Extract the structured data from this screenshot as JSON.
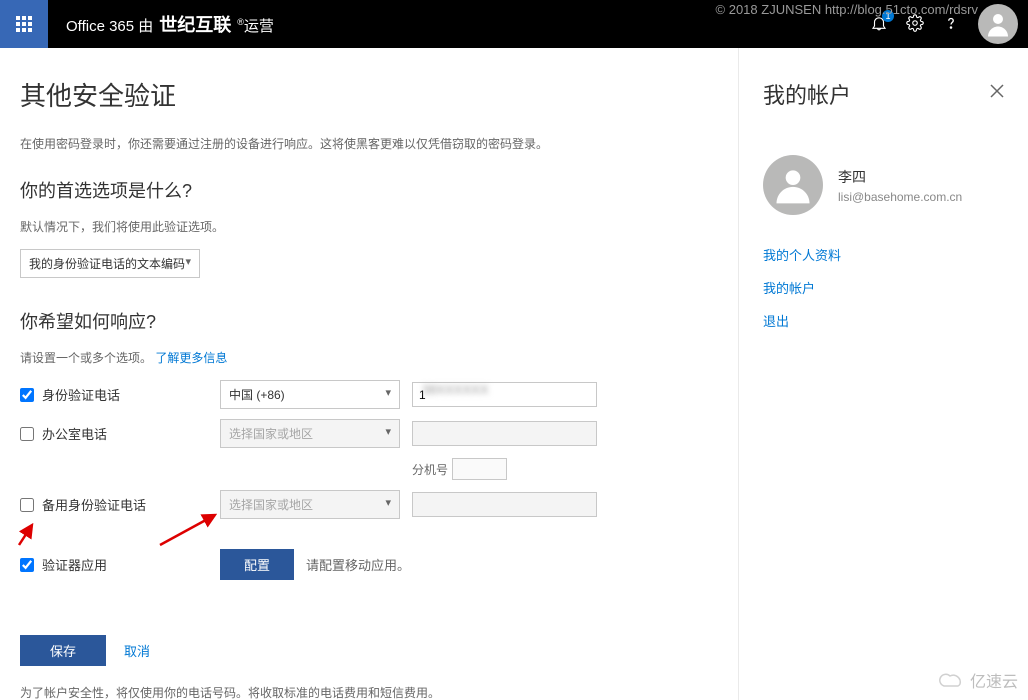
{
  "watermark": "© 2018 ZJUNSEN http://blog.51cto.com/rdsrv",
  "header": {
    "brand_prefix": "Office 365 由",
    "brand_bold": "世纪互联",
    "brand_suffix": "运营",
    "notification_badge": "1"
  },
  "main": {
    "title": "其他安全验证",
    "subtitle": "在使用密码登录时，你还需要通过注册的设备进行响应。这将使黑客更难以仅凭借窃取的密码登录。",
    "pref_heading": "你的首选选项是什么?",
    "pref_note": "默认情况下，我们将使用此验证选项。",
    "pref_select": "我的身份验证电话的文本编码",
    "respond_heading": "你希望如何响应?",
    "respond_note_prefix": "请设置一个或多个选项。",
    "respond_link": "了解更多信息",
    "opts": {
      "auth_phone": "身份验证电话",
      "office_phone": "办公室电话",
      "alt_phone": "备用身份验证电话",
      "auth_app": "验证器应用",
      "country_selected": "中国 (+86)",
      "country_placeholder": "选择国家或地区",
      "phone_value": "1",
      "ext_label": "分机号"
    },
    "configure_btn": "配置",
    "configure_note": "请配置移动应用。",
    "save_btn": "保存",
    "cancel_btn": "取消",
    "footer": "为了帐户安全性，将仅使用你的电话号码。将收取标准的电话费用和短信费用。"
  },
  "side": {
    "title": "我的帐户",
    "name": "李四",
    "email": "lisi@basehome.com.cn",
    "link_profile": "我的个人资料",
    "link_account": "我的帐户",
    "link_signout": "退出"
  },
  "bottom_logo": "亿速云"
}
